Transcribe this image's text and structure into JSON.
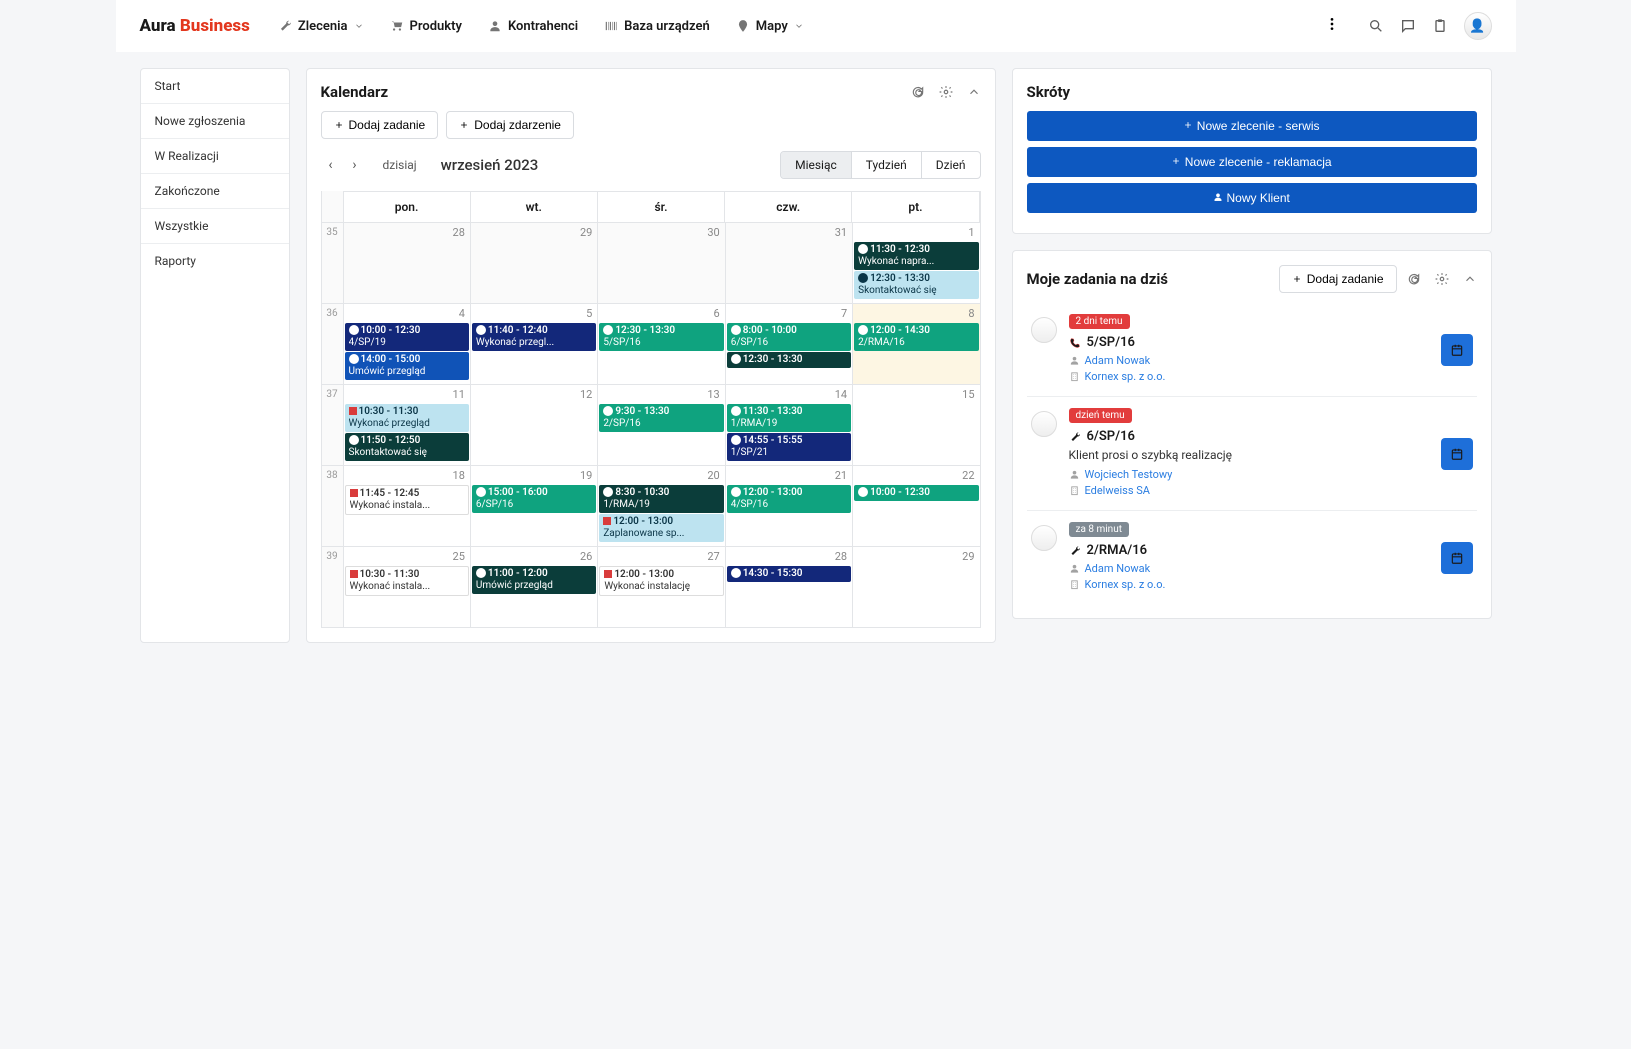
{
  "brand": {
    "a": "Aura",
    "b": "Business"
  },
  "nav": [
    {
      "label": "Zlecenia",
      "chevron": true
    },
    {
      "label": "Produkty"
    },
    {
      "label": "Kontrahenci"
    },
    {
      "label": "Baza urządzeń"
    },
    {
      "label": "Mapy",
      "chevron": true
    }
  ],
  "sidebar": [
    "Start",
    "Nowe zgłoszenia",
    "W Realizacji",
    "Zakończone",
    "Wszystkie",
    "Raporty"
  ],
  "calendar": {
    "title": "Kalendarz",
    "add_task": "Dodaj zadanie",
    "add_event": "Dodaj zdarzenie",
    "today": "dzisiaj",
    "month_label": "wrzesień 2023",
    "views": {
      "month": "Miesiąc",
      "week": "Tydzień",
      "day": "Dzień"
    },
    "dow": [
      "pon.",
      "wt.",
      "śr.",
      "czw.",
      "pt."
    ],
    "weeks": [
      {
        "wk": "35",
        "days": [
          {
            "d": "28",
            "off": true
          },
          {
            "d": "29",
            "off": true
          },
          {
            "d": "30",
            "off": true
          },
          {
            "d": "31",
            "off": true
          },
          {
            "d": "1",
            "events": [
              {
                "c": "c-dg",
                "t": "11:30 - 12:30",
                "l": "Wykonać napra..."
              },
              {
                "c": "c-lb",
                "t": "12:30 - 13:30",
                "l": "Skontaktować się"
              }
            ]
          }
        ]
      },
      {
        "wk": "36",
        "days": [
          {
            "d": "4",
            "events": [
              {
                "c": "c-db",
                "t": "10:00 - 12:30",
                "l": "4/SP/19"
              },
              {
                "c": "c-bl",
                "t": "14:00 - 15:00",
                "l": "Umówić przegląd"
              }
            ]
          },
          {
            "d": "5",
            "events": [
              {
                "c": "c-db",
                "t": "11:40 - 12:40",
                "l": "Wykonać przegl..."
              }
            ]
          },
          {
            "d": "6",
            "events": [
              {
                "c": "c-gr",
                "t": "12:30 - 13:30",
                "l": "5/SP/16"
              }
            ]
          },
          {
            "d": "7",
            "events": [
              {
                "c": "c-gr",
                "t": "8:00 - 10:00",
                "l": "6/SP/16"
              },
              {
                "c": "c-dg",
                "t": "12:30 - 13:30",
                "l": ""
              }
            ]
          },
          {
            "d": "8",
            "today": true,
            "events": [
              {
                "c": "c-gr",
                "t": "12:00 - 14:30",
                "l": "2/RMA/16"
              }
            ]
          }
        ]
      },
      {
        "wk": "37",
        "days": [
          {
            "d": "11",
            "events": [
              {
                "c": "c-lb c-flag",
                "t": "10:30 - 11:30",
                "l": "Wykonać przegląd"
              },
              {
                "c": "c-dg",
                "t": "11:50 - 12:50",
                "l": "Skontaktować się"
              }
            ]
          },
          {
            "d": "12"
          },
          {
            "d": "13",
            "events": [
              {
                "c": "c-gr",
                "t": "9:30 - 13:30",
                "l": "2/SP/16"
              }
            ]
          },
          {
            "d": "14",
            "events": [
              {
                "c": "c-gr",
                "t": "11:30 - 13:30",
                "l": "1/RMA/19"
              },
              {
                "c": "c-db",
                "t": "14:55 - 15:55",
                "l": "1/SP/21"
              }
            ]
          },
          {
            "d": "15"
          }
        ]
      },
      {
        "wk": "38",
        "days": [
          {
            "d": "18",
            "events": [
              {
                "c": "c-wh c-flag",
                "t": "11:45 - 12:45",
                "l": "Wykonać instala..."
              }
            ]
          },
          {
            "d": "19",
            "events": [
              {
                "c": "c-gr",
                "t": "15:00 - 16:00",
                "l": "6/SP/16"
              }
            ]
          },
          {
            "d": "20",
            "events": [
              {
                "c": "c-dg",
                "t": "8:30 - 10:30",
                "l": "1/RMA/19"
              },
              {
                "c": "c-lb c-flag",
                "t": "12:00 - 13:00",
                "l": "Zaplanowane sp..."
              }
            ]
          },
          {
            "d": "21",
            "events": [
              {
                "c": "c-gr",
                "t": "12:00 - 13:00",
                "l": "4/SP/16"
              }
            ]
          },
          {
            "d": "22",
            "events": [
              {
                "c": "c-gr",
                "t": "10:00 - 12:30",
                "l": ""
              }
            ]
          }
        ]
      },
      {
        "wk": "39",
        "days": [
          {
            "d": "25",
            "events": [
              {
                "c": "c-wh c-flag",
                "t": "10:30 - 11:30",
                "l": "Wykonać instala..."
              }
            ]
          },
          {
            "d": "26",
            "events": [
              {
                "c": "c-dg",
                "t": "11:00 - 12:00",
                "l": "Umówić przegląd"
              }
            ]
          },
          {
            "d": "27",
            "events": [
              {
                "c": "c-wh c-flag",
                "t": "12:00 - 13:00",
                "l": "Wykonać instalację"
              }
            ]
          },
          {
            "d": "28",
            "events": [
              {
                "c": "c-db",
                "t": "14:30 - 15:30",
                "l": ""
              }
            ]
          },
          {
            "d": "29"
          }
        ]
      }
    ]
  },
  "shortcuts": {
    "title": "Skróty",
    "btns": [
      "Nowe zlecenie - serwis",
      "Nowe zlecenie - reklamacja",
      "Nowy Klient"
    ]
  },
  "tasks": {
    "title": "Moje zadania na dziś",
    "add": "Dodaj zadanie",
    "items": [
      {
        "badge": "2 dni temu",
        "bc": "bg-red",
        "icon": "phone",
        "ref": "5/SP/16",
        "person": "Adam Nowak",
        "company": "Kornex sp. z o.o."
      },
      {
        "badge": "dzień temu",
        "bc": "bg-red",
        "icon": "wrench",
        "ref": "6/SP/16",
        "note": "Klient prosi o szybką realizację",
        "person": "Wojciech Testowy",
        "company": "Edelweiss SA"
      },
      {
        "badge": "za 8 minut",
        "bc": "bg-gray",
        "icon": "wrench",
        "ref": "2/RMA/16",
        "person": "Adam Nowak",
        "company": "Kornex sp. z o.o."
      }
    ]
  }
}
